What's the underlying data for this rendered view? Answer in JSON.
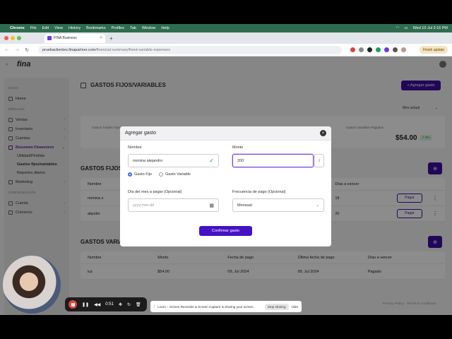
{
  "menubar": {
    "app": "Chrome",
    "menus": [
      "File",
      "Edit",
      "View",
      "History",
      "Bookmarks",
      "Profiles",
      "Tab",
      "Window",
      "Help"
    ],
    "clock": "Wed 10 Jul 3:16 PM"
  },
  "browser": {
    "tab_title": "FINA Business",
    "url_host": "pruebaclientes.finapartner.com",
    "url_path": "/financial-summary/fixed-variable-expenses",
    "finish_update": "Finish update"
  },
  "app": {
    "logo": "fina"
  },
  "sidebar": {
    "sec_home": "Inicio",
    "home": "Home",
    "sec_modules": "Módulos",
    "ventas": "Ventas",
    "inventario": "Inventario",
    "cuentas": "Cuentas",
    "resumen": "Resumen Financiero",
    "utilidad": "Utilidad/Pérdida",
    "gastos": "Gastos fijos/variables",
    "reportes": "Reportes diarios",
    "marketing": "Marketing",
    "sec_config": "Configuración",
    "cuenta": "Cuenta",
    "comercio": "Comercio"
  },
  "main": {
    "title": "GASTOS FIJOS/VARIABLES",
    "add_button": "+ Agregar gasto",
    "month": "Mes actual",
    "stat_left": "Gastos Totales Fijos",
    "stat_right": "Gastos Variables Pagados",
    "stat_value": "$54.00",
    "stat_badge": "↗ 0%",
    "fixed_title": "GASTOS FIJOS",
    "var_title": "GASTOS VARIABLES",
    "fixed_headers": [
      "Nombre",
      "",
      "",
      "",
      "Días a vencer",
      ""
    ],
    "fixed_rows": [
      {
        "name": "nomina s",
        "days": "18",
        "action": "Pagar"
      },
      {
        "name": "alquiler",
        "days": "20",
        "action": "Pagar"
      }
    ],
    "var_headers": [
      "Nombre",
      "Monto",
      "Fecha de pago",
      "Última fecha de pago",
      "Días a vencer"
    ],
    "var_rows": [
      {
        "name": "luz",
        "amount": "$54.00",
        "date": "09, Jul 2024",
        "last": "09, Jul 2024",
        "status": "Pagado"
      }
    ],
    "footer": "Privacy Policy · Terms & Conditions"
  },
  "modal": {
    "title": "Agregar gasto",
    "name_label": "Nombre",
    "name_value": "nomina alejandro",
    "amount_label": "Monto",
    "amount_value": "200",
    "radio_fixed": "Gasto Fijo",
    "radio_variable": "Gasto Variable",
    "day_label": "Día del mes a pagar (Opcional)",
    "day_placeholder": "yyyy-mm-dd",
    "freq_label": "Frecuencia de pago (Opcional)",
    "freq_value": "Mensual",
    "confirm": "Confirmar gasto"
  },
  "loom": {
    "timer": "0:51",
    "notice": "Loom – Screen Recorder & Screen Capture is sharing your screen.",
    "stop": "Stop sharing",
    "hide": "Hide"
  }
}
